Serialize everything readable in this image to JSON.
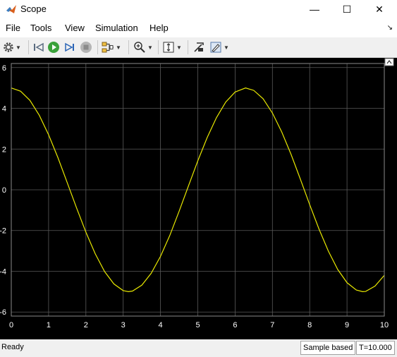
{
  "window": {
    "title": "Scope",
    "minimize_glyph": "—",
    "maximize_glyph": "☐",
    "close_glyph": "✕"
  },
  "menu": {
    "items": [
      "File",
      "Tools",
      "View",
      "Simulation",
      "Help"
    ]
  },
  "toolbar": {
    "icons": [
      "gear-icon",
      "step-back-icon",
      "run-icon",
      "step-forward-icon",
      "stop-icon",
      "signal-selector-icon",
      "zoom-in-icon",
      "autoscale-icon",
      "highlight-simulink-block-icon",
      "style-icon"
    ]
  },
  "status": {
    "ready": "Ready",
    "sample_mode": "Sample based",
    "time": "T=10.000"
  },
  "colors": {
    "trace": "#e8e800",
    "grid": "#5a5a5a",
    "axes_bg": "#000000",
    "tick_label": "#ffffff"
  },
  "chart_data": {
    "type": "line",
    "title": "",
    "xlabel": "",
    "ylabel": "",
    "xlim": [
      0,
      10
    ],
    "ylim": [
      -6.2,
      6.2
    ],
    "xticks": [
      0,
      1,
      2,
      3,
      4,
      5,
      6,
      7,
      8,
      9,
      10
    ],
    "yticks": [
      -6,
      -4,
      -2,
      0,
      2,
      4,
      6
    ],
    "grid": true,
    "series": [
      {
        "x": [
          0,
          0.25,
          0.5,
          0.75,
          1,
          1.25,
          1.5,
          1.75,
          2,
          2.25,
          2.5,
          2.75,
          3,
          3.14,
          3.25,
          3.5,
          3.75,
          4,
          4.25,
          4.5,
          4.75,
          5,
          5.25,
          5.5,
          5.75,
          6,
          6.28,
          6.5,
          6.75,
          7,
          7.25,
          7.5,
          7.75,
          8,
          8.25,
          8.5,
          8.75,
          9,
          9.25,
          9.42,
          9.5,
          9.75,
          10
        ],
        "y": [
          5,
          4.84,
          4.39,
          3.66,
          2.7,
          1.58,
          0.35,
          -0.89,
          -2.08,
          -3.14,
          -4.01,
          -4.62,
          -4.95,
          -5,
          -4.97,
          -4.68,
          -4.1,
          -3.27,
          -2.24,
          -1.05,
          0.19,
          1.42,
          2.56,
          3.54,
          4.31,
          4.8,
          5,
          4.88,
          4.47,
          3.77,
          2.84,
          1.74,
          0.52,
          -0.73,
          -1.93,
          -3.01,
          -3.91,
          -4.56,
          -4.92,
          -5,
          -4.99,
          -4.73,
          -4.2
        ]
      }
    ]
  }
}
